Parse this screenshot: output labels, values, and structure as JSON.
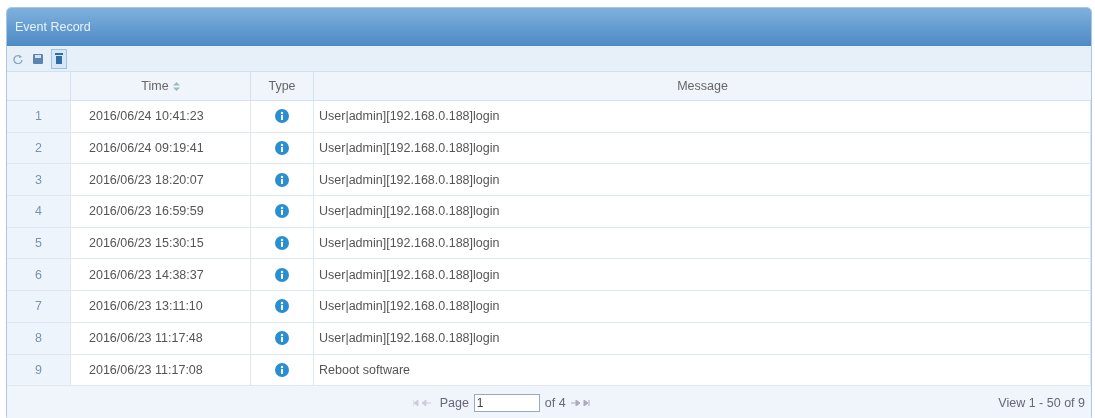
{
  "panel": {
    "title": "Event Record"
  },
  "table": {
    "columns": [
      "Time",
      "Type",
      "Message"
    ],
    "rows": [
      {
        "index": "1",
        "time": "2016/06/24 10:41:23",
        "message": "User|admin][192.168.0.188]login"
      },
      {
        "index": "2",
        "time": "2016/06/24 09:19:41",
        "message": "User|admin][192.168.0.188]login"
      },
      {
        "index": "3",
        "time": "2016/06/23 18:20:07",
        "message": "User|admin][192.168.0.188]login"
      },
      {
        "index": "4",
        "time": "2016/06/23 16:59:59",
        "message": "User|admin][192.168.0.188]login"
      },
      {
        "index": "5",
        "time": "2016/06/23 15:30:15",
        "message": "User|admin][192.168.0.188]login"
      },
      {
        "index": "6",
        "time": "2016/06/23 14:38:37",
        "message": "User|admin][192.168.0.188]login"
      },
      {
        "index": "7",
        "time": "2016/06/23 13:11:10",
        "message": "User|admin][192.168.0.188]login"
      },
      {
        "index": "8",
        "time": "2016/06/23 11:17:48",
        "message": "User|admin][192.168.0.188]login"
      },
      {
        "index": "9",
        "time": "2016/06/23 11:17:08",
        "message": "Reboot software"
      }
    ]
  },
  "pager": {
    "page_label": "Page",
    "page": "1",
    "of_label": "of 4",
    "summary": "View 1 - 50 of 9"
  }
}
